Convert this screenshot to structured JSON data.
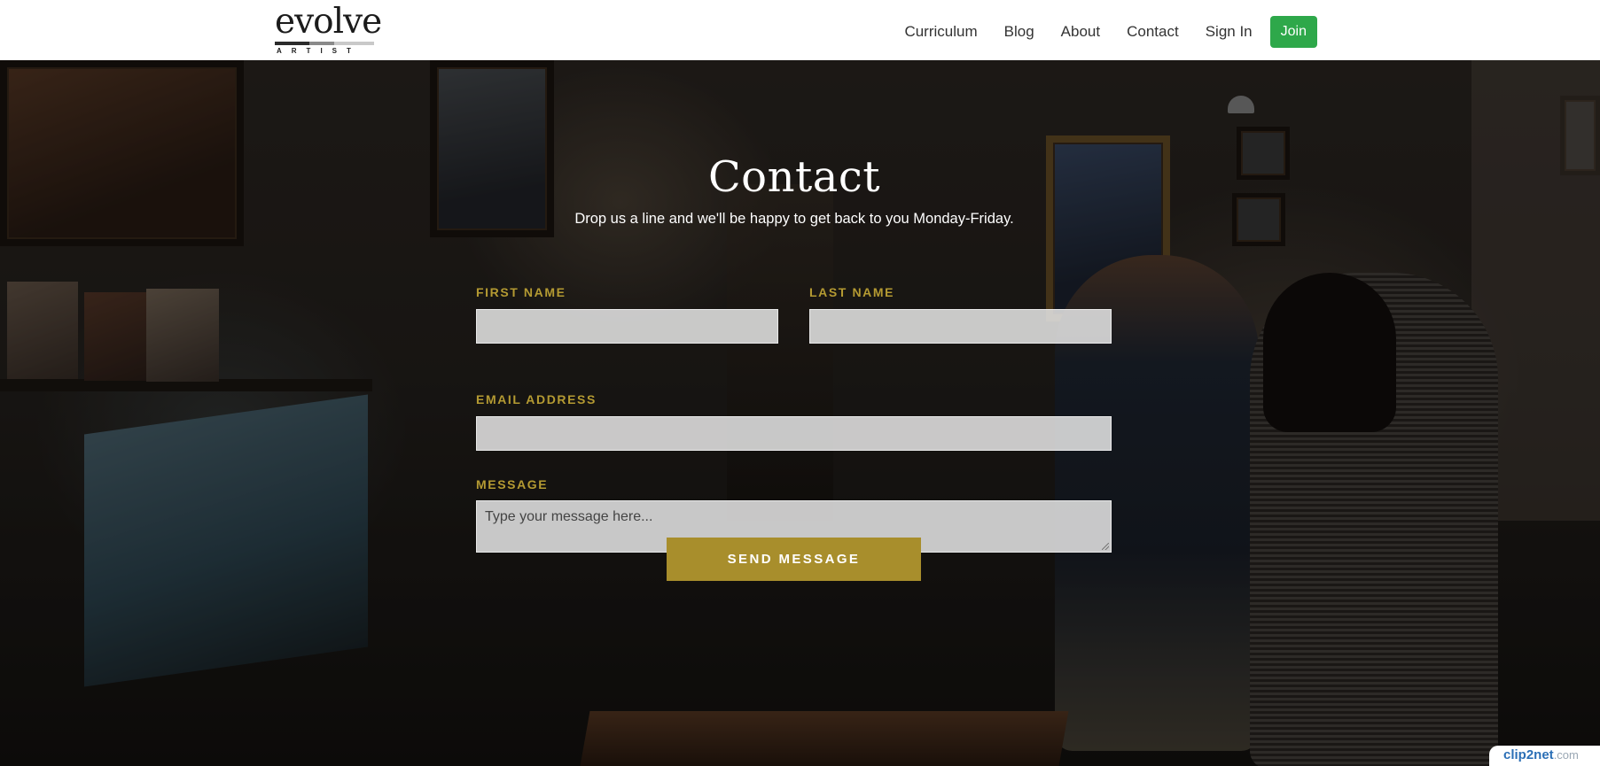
{
  "header": {
    "logo": {
      "word": "evolve",
      "sub": "ARTIST"
    },
    "nav": [
      {
        "label": "Curriculum"
      },
      {
        "label": "Blog"
      },
      {
        "label": "About"
      },
      {
        "label": "Contact"
      },
      {
        "label": "Sign In"
      }
    ],
    "join_label": "Join"
  },
  "main": {
    "title": "Contact",
    "subtitle": "Drop us a line and we'll be happy to get back to you Monday-Friday.",
    "form": {
      "first_name": {
        "label": "FIRST NAME",
        "value": ""
      },
      "last_name": {
        "label": "LAST NAME",
        "value": ""
      },
      "email": {
        "label": "EMAIL ADDRESS",
        "value": ""
      },
      "message": {
        "label": "MESSAGE",
        "placeholder": "Type your message here...",
        "value": ""
      },
      "submit_label": "SEND MESSAGE"
    }
  },
  "watermark": {
    "brand": "clip2net",
    "domain": ".com"
  },
  "colors": {
    "accent_gold": "#b49a32",
    "button_gold": "#a88e2c",
    "join_green": "#2ea84a",
    "header_bg": "#ffffff"
  }
}
